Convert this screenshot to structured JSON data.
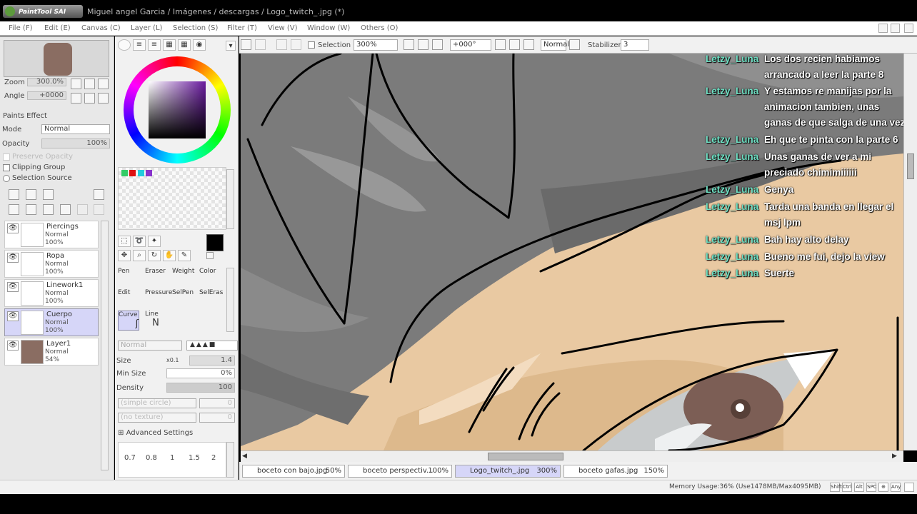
{
  "app": {
    "name": "PaintTool SAI",
    "window_title": "Miguel angel Garcia / Imágenes / descargas / Logo_twitch_.jpg (*)"
  },
  "menu": [
    "File (F)",
    "Edit (E)",
    "Canvas (C)",
    "Layer (L)",
    "Selection (S)",
    "Filter (T)",
    "View (V)",
    "Window (W)",
    "Others (O)"
  ],
  "navigator": {
    "zoom_label": "Zoom",
    "zoom_value": "300.0%",
    "angle_label": "Angle",
    "angle_value": "+0000"
  },
  "layer_props": {
    "paints_effect": "Paints Effect",
    "mode_label": "Mode",
    "mode_value": "Normal",
    "opacity_label": "Opacity",
    "opacity_value": "100%",
    "preserve_opacity": "Preserve Opacity",
    "clipping_group": "Clipping Group",
    "selection_source": "Selection Source"
  },
  "layers": [
    {
      "name": "Piercings",
      "mode": "Normal",
      "opacity": "100%",
      "selected": false
    },
    {
      "name": "Ropa",
      "mode": "Normal",
      "opacity": "100%",
      "selected": false
    },
    {
      "name": "Linework1",
      "mode": "Normal",
      "opacity": "100%",
      "selected": false
    },
    {
      "name": "Cuerpo",
      "mode": "Normal",
      "opacity": "100%",
      "selected": true
    },
    {
      "name": "Layer1",
      "mode": "Normal",
      "opacity": "54%",
      "selected": false
    }
  ],
  "colors": {
    "primary": "#000000",
    "swatches": [
      "#33cc66",
      "#dd1111",
      "#22ccdd",
      "#8833cc"
    ],
    "accent_selected": "#d6d6f8",
    "chat_username": "#6fe0c4"
  },
  "tools": {
    "brushes": [
      {
        "name": "Pen",
        "selected": false
      },
      {
        "name": "Eraser",
        "selected": false
      },
      {
        "name": "Weight",
        "selected": false
      },
      {
        "name": "Color",
        "selected": false
      },
      {
        "name": "Edit",
        "selected": false
      },
      {
        "name": "Pressure",
        "selected": false
      },
      {
        "name": "SelPen",
        "selected": false
      },
      {
        "name": "SelEras",
        "selected": false
      },
      {
        "name": "Curve",
        "selected": true
      },
      {
        "name": "Line",
        "selected": false
      }
    ],
    "blend_mode": "Normal",
    "size_label": "Size",
    "size_multiplier": "x0.1",
    "size_value": "1.4",
    "min_size_label": "Min Size",
    "min_size_value": "0%",
    "density_label": "Density",
    "density_value": "100",
    "shape_option": "(simple circle)",
    "shape_value": "0",
    "texture_option": "(no texture)",
    "texture_value": "0",
    "advanced_settings": "Advanced Settings",
    "size_presets": [
      "0.7",
      "0.8",
      "1",
      "1.5",
      "2"
    ]
  },
  "canvas_toolbar": {
    "selection_label": "Selection",
    "zoom_value": "300%",
    "rotation_value": "+000°",
    "blend_value": "Normal",
    "stabilizer_label": "Stabilizer",
    "stabilizer_value": "3"
  },
  "chat": [
    {
      "user": "Letzy_Luna",
      "lines": [
        "Los dos recien habiamos",
        "arrancado a leer la parte 8"
      ]
    },
    {
      "user": "Letzy_Luna",
      "lines": [
        "Y estamos re manijas por la",
        "animacion tambien, unas",
        "ganas de que salga de una vez"
      ]
    },
    {
      "user": "Letzy_Luna",
      "lines": [
        "Eh que te pinta con la parte 6"
      ]
    },
    {
      "user": "Letzy_Luna",
      "lines": [
        "Unas ganas de ver a mi",
        "preciado chimimiiiiii"
      ]
    },
    {
      "user": "Letzy_Luna",
      "lines": [
        "Genya"
      ]
    },
    {
      "user": "Letzy_Luna",
      "lines": [
        "Tarda una banda en llegar el",
        "msj lpm"
      ]
    },
    {
      "user": "Letzy_Luna",
      "lines": [
        "Bah hay alto delay"
      ]
    },
    {
      "user": "Letzy_Luna",
      "lines": [
        "Bueno me fui, dejo la view"
      ]
    },
    {
      "user": "Letzy_Luna",
      "lines": [
        "Suerte"
      ]
    }
  ],
  "tabs": [
    {
      "name": "boceto con bajo.jpg",
      "zoom": "50%",
      "selected": false
    },
    {
      "name": "boceto perspectiv...",
      "zoom": "100%",
      "selected": false
    },
    {
      "name": "Logo_twitch_.jpg",
      "zoom": "300%",
      "selected": true
    },
    {
      "name": "boceto gafas.jpg",
      "zoom": "150%",
      "selected": false
    }
  ],
  "status": {
    "memory": "Memory Usage:36% (Use1478MB/Max4095MB)",
    "keys": [
      "Shift",
      "Ctrl",
      "Alt",
      "SPC",
      "⊕",
      "Any"
    ]
  }
}
